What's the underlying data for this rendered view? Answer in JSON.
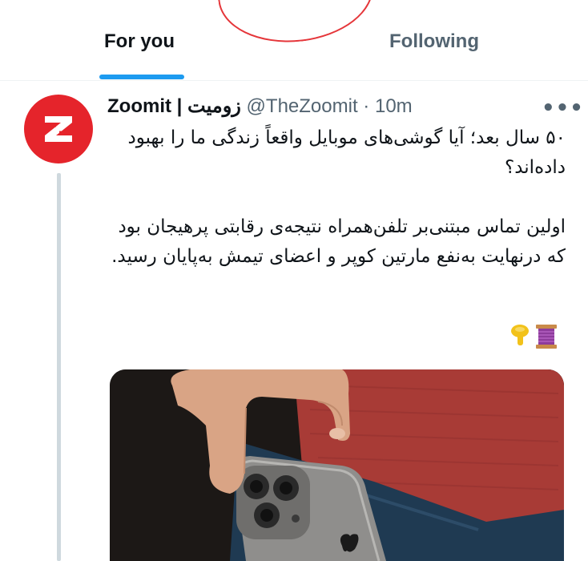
{
  "tabs": {
    "for_you": "For you",
    "following": "Following"
  },
  "tweet": {
    "display_name": "Zoomit | زومیت",
    "handle": "@TheZoomit",
    "separator": "·",
    "time": "10m",
    "more_icon": "more-icon",
    "text_line1": "۵۰ سال بعد؛ آیا گوشی‌های موبایل واقعاً زندگی ما را بهبود داده‌اند؟",
    "text_line2": "اولین تماس مبتنی‌بر تلفن‌همراه نتیجه‌ی رقابتی پرهیجان بود که درنهایت به‌نفع مارتین کوپر و اعضای تیمش به‌پایان رسید.",
    "emojis": [
      "thread-spool-icon",
      "pin-pointing-down-icon"
    ],
    "media_description_icon": "phone-in-pocket-image"
  },
  "colors": {
    "accent": "#1d9bf0",
    "brand": "#e5242b",
    "annotation": "#e5363a"
  }
}
